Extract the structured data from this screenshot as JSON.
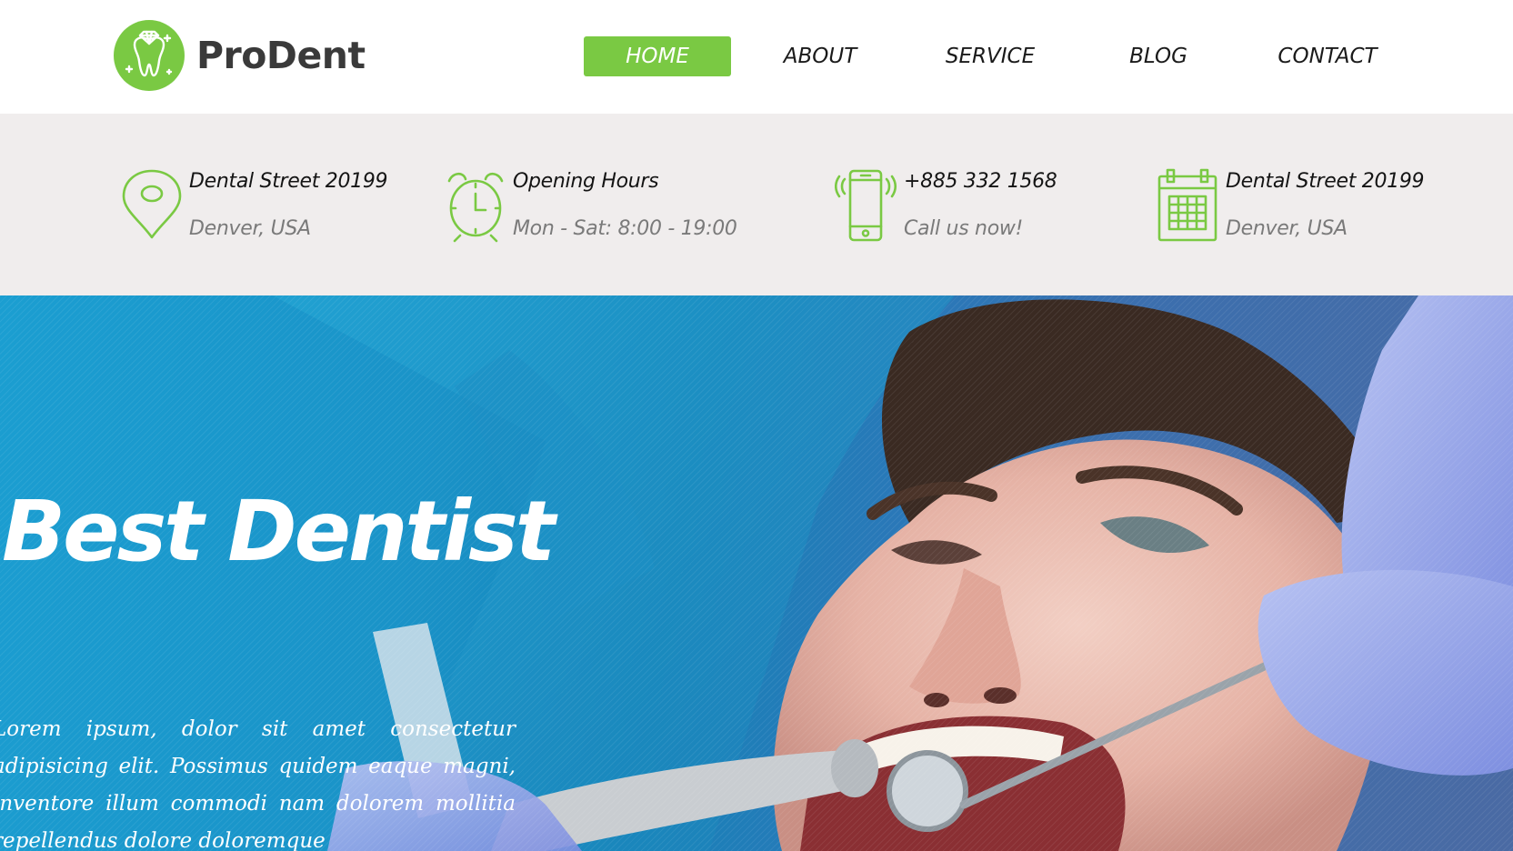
{
  "brand": {
    "name": "ProDent",
    "accent_color": "#7ac943",
    "logo_icon": "tooth-diamond-icon"
  },
  "nav": {
    "items": [
      {
        "label": "HOME",
        "active": true
      },
      {
        "label": "ABOUT",
        "active": false
      },
      {
        "label": "SERVICE",
        "active": false
      },
      {
        "label": "BLOG",
        "active": false
      },
      {
        "label": "CONTACT",
        "active": false
      }
    ]
  },
  "info_bar": {
    "items": [
      {
        "icon": "map-pin-icon",
        "title": "Dental Street 20199",
        "subtitle": "Denver, USA"
      },
      {
        "icon": "alarm-clock-icon",
        "title": "Opening Hours",
        "subtitle": "Mon - Sat: 8:00 - 19:00"
      },
      {
        "icon": "phone-icon",
        "title": "+885 332 1568",
        "subtitle": "Call us now!"
      },
      {
        "icon": "calendar-icon",
        "title": "Dental Street 20199",
        "subtitle": "Denver, USA"
      }
    ]
  },
  "hero": {
    "title": "Best Dentist",
    "body": "Lorem ipsum, dolor sit amet consectetur adipisicing elit. Possimus quidem eaque magni, inventore illum commodi nam dolorem mollitia repellendus dolore doloremque",
    "image": "dentist-examining-patient-photo"
  }
}
